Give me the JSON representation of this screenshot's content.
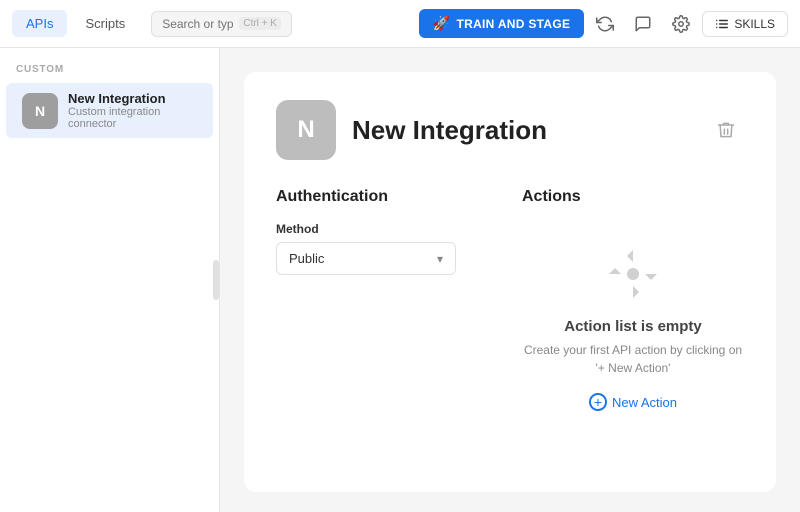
{
  "topNav": {
    "tabs": [
      {
        "id": "apis",
        "label": "APIs",
        "active": true
      },
      {
        "id": "scripts",
        "label": "Scripts",
        "active": false
      }
    ],
    "search": {
      "placeholder": "Search or type a command...",
      "shortcut": "Ctrl + K"
    },
    "trainButton": {
      "label": "TRAIN AND STAGE",
      "icon": "rocket-icon"
    },
    "skillsButton": {
      "label": "SKILLS",
      "icon": "list-icon"
    }
  },
  "sidebar": {
    "sectionLabel": "CUSTOM",
    "items": [
      {
        "id": "new-integration",
        "avatarLetter": "N",
        "title": "New Integration",
        "subtitle": "Custom integration connector"
      }
    ]
  },
  "content": {
    "integration": {
      "avatarLetter": "N",
      "title": "New Integration"
    },
    "authentication": {
      "sectionTitle": "Authentication",
      "methodLabel": "Method",
      "methodValue": "Public"
    },
    "actions": {
      "sectionTitle": "Actions",
      "emptyTitle": "Action list is empty",
      "emptyDesc": "Create your first API action by clicking on '+ New Action'",
      "newActionLabel": "New Action"
    }
  }
}
